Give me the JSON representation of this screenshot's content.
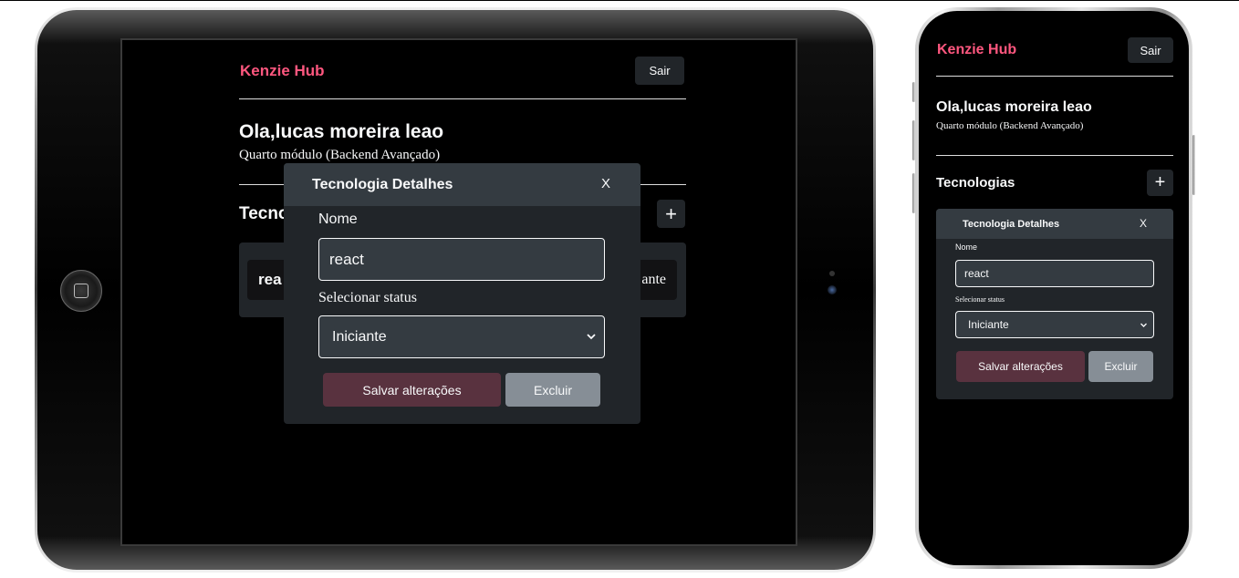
{
  "app": {
    "logo": "Kenzie Hub",
    "exit_label": "Sair",
    "greeting": "Ola,lucas moreira leao",
    "module": "Quarto módulo (Backend Avançado)",
    "technologies_title": "Tecnologias",
    "add_label": "+",
    "technologies": [
      {
        "name": "react",
        "status": "Iniciante"
      }
    ]
  },
  "modal": {
    "title": "Tecnologia Detalhes",
    "close_label": "X",
    "name_label": "Nome",
    "name_value": "react",
    "status_label": "Selecionar status",
    "status_value": "Iniciante",
    "save_label": "Salvar alterações",
    "delete_label": "Excluir"
  },
  "tablet_view": {
    "technologies_title_visible": "Tecno",
    "item_name_visible": "rea",
    "item_status_visible": "ante"
  },
  "colors": {
    "brand": "#ff577f",
    "background": "#000000",
    "surface": "#212529",
    "surface_light": "#343b41",
    "save_button": "#59323f",
    "delete_button": "#868e96",
    "text": "#f8f9fa"
  }
}
